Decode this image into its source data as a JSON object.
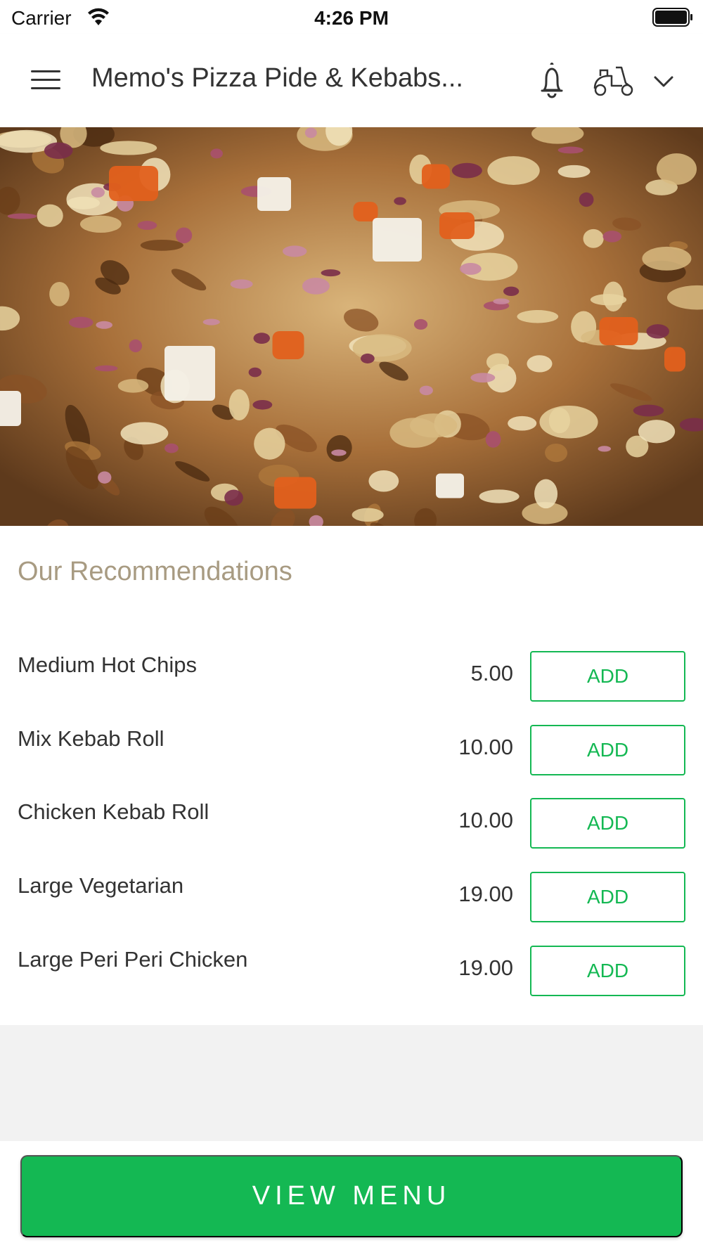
{
  "status_bar": {
    "carrier": "Carrier",
    "time": "4:26 PM"
  },
  "header": {
    "title": "Memo's Pizza Pide & Kebabs...",
    "icons": [
      "menu-icon",
      "bell-icon",
      "scooter-icon",
      "chevron-down-icon"
    ]
  },
  "recommendations": {
    "title": "Our Recommendations",
    "items": [
      {
        "name": "Medium Hot Chips",
        "price": "5.00",
        "button": "ADD"
      },
      {
        "name": "Mix Kebab Roll",
        "price": "10.00",
        "button": "ADD"
      },
      {
        "name": "Chicken Kebab Roll",
        "price": "10.00",
        "button": "ADD"
      },
      {
        "name": "Large Vegetarian",
        "price": "19.00",
        "button": "ADD"
      },
      {
        "name": "Large Peri Peri Chicken",
        "price": "19.00",
        "button": "ADD"
      }
    ]
  },
  "footer": {
    "view_menu_label": "VIEW MENU"
  },
  "colors": {
    "accent_green": "#14b853",
    "section_title": "#a89b82",
    "background_gray": "#f2f2f2"
  }
}
